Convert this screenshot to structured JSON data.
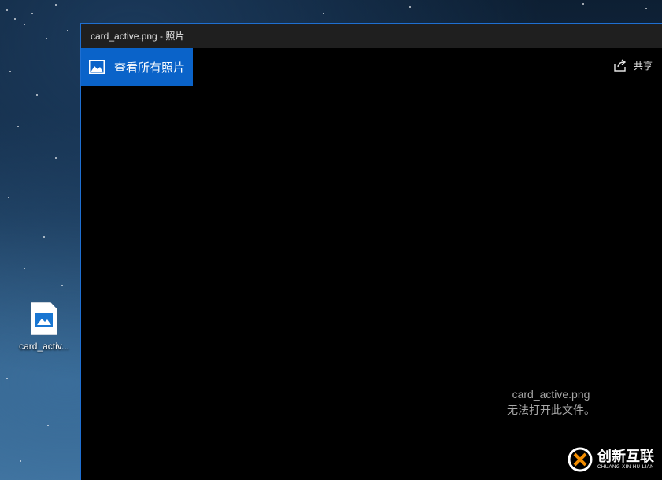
{
  "desktop": {
    "file_icon_label": "card_activ..."
  },
  "window": {
    "title": "card_active.png - 照片",
    "toolbar": {
      "view_all_label": "查看所有照片",
      "share_label": "共享"
    },
    "viewer": {
      "file_name": "card_active.png",
      "error_message": "无法打开此文件。"
    }
  },
  "watermark": {
    "brand_cn": "创新互联",
    "brand_en": "CHUANG XIN HU LIAN"
  },
  "colors": {
    "accent": "#0a63c9",
    "window_border": "#1f6fd1",
    "titlebar": "#1f1f1f",
    "viewer_bg": "#000000"
  }
}
